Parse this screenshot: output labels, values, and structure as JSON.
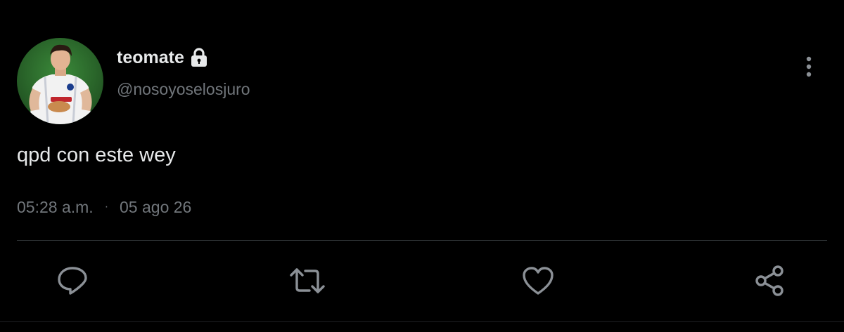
{
  "user": {
    "display_name": "teomate",
    "handle": "@nosoyoselosjuro",
    "avatar_icon": "profile-photo",
    "protected_icon": "lock-icon"
  },
  "tweet": {
    "text": "qpd con este wey",
    "time": "05:28 a.m.",
    "separator": "·",
    "date": "05 ago 26"
  },
  "actions": {
    "reply_icon": "reply-icon",
    "retweet_icon": "retweet-icon",
    "like_icon": "heart-icon",
    "share_icon": "share-icon",
    "more_icon": "more-vertical-icon"
  },
  "colors": {
    "background": "#000000",
    "text_primary": "#e7e9ea",
    "text_secondary": "#71767b",
    "icon": "#71767b",
    "divider": "#2f3336"
  }
}
